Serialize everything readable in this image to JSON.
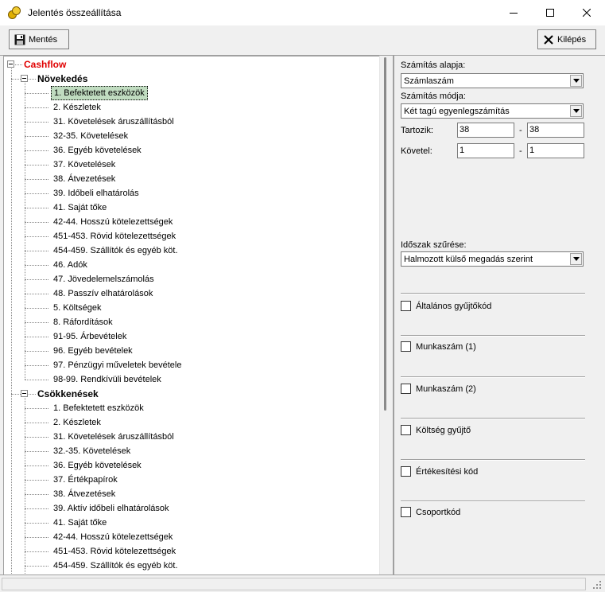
{
  "window": {
    "title": "Jelentés összeállítása"
  },
  "toolbar": {
    "save_label": "Mentés",
    "exit_label": "Kilépés"
  },
  "tree": {
    "root": "Cashflow",
    "groups": [
      {
        "label": "Növekedés",
        "items": [
          "1. Befektetett eszközök",
          "2. Készletek",
          "31. Követelések áruszállításból",
          "32-35. Követelések",
          "36. Egyéb követelések",
          "37. Követelések",
          "38. Átvezetések",
          "39. Időbeli elhatárolás",
          "41. Saját tőke",
          "42-44. Hosszú kötelezettségek",
          "451-453. Rövid kötelezettségek",
          "454-459. Szállítók és egyéb köt.",
          "46. Adók",
          "47. Jövedelemelszámolás",
          "48. Passzív elhatárolások",
          "5. Költségek",
          "8. Ráfordítások",
          "91-95. Árbevételek",
          "96. Egyéb bevételek",
          "97. Pénzügyi műveletek bevétele",
          "98-99. Rendkívüli bevételek"
        ]
      },
      {
        "label": "Csökkenések",
        "items": [
          "1. Befektetett eszközök",
          "2. Készletek",
          "31. Követelések áruszállításból",
          "32.-35. Követelések",
          "36. Egyéb követelések",
          "37. Értékpapírok",
          "38. Átvezetések",
          "39. Aktív időbeli elhatárolások",
          "41. Saját tőke",
          "42-44. Hosszú kötelezettségek",
          "451-453. Rövid kötelezettségek",
          "454-459. Szállítók és egyéb köt."
        ]
      }
    ]
  },
  "right": {
    "calc_base_label": "Számítás alapja:",
    "calc_base_value": "Számlaszám",
    "calc_mode_label": "Számítás módja:",
    "calc_mode_value": "Két tagú egyenlegszámítás",
    "debit_label": "Tartozik:",
    "debit_from": "38",
    "debit_to": "38",
    "credit_label": "Követel:",
    "credit_from": "1",
    "credit_to": "1",
    "dash": "-",
    "period_label": "Időszak szűrése:",
    "period_value": "Halmozott külső megadás szerint",
    "checkboxes": [
      "Általános gyűjtőkód",
      "Munkaszám (1)",
      "Munkaszám (2)",
      "Költség gyűjtő",
      "Értékesítési kód",
      "Csoportkód"
    ]
  },
  "icons": {
    "app": "coins-icon",
    "save": "floppy-disk-icon",
    "exit": "x-icon",
    "dropdown": "chevron-down-icon"
  }
}
